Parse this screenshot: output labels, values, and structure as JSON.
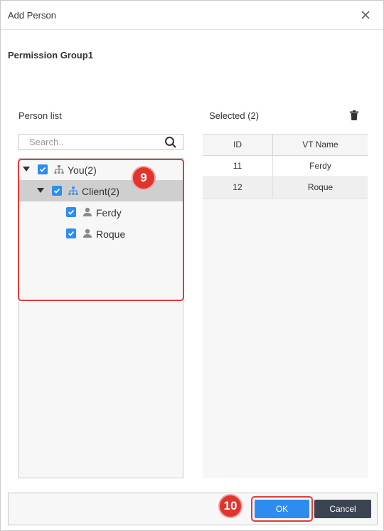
{
  "dialog": {
    "title": "Add Person"
  },
  "group": {
    "name": "Permission Group1"
  },
  "person_list": {
    "label": "Person list",
    "search_placeholder": "Search..",
    "tree": [
      {
        "label": "You(2)",
        "checked": true,
        "expanded": true,
        "icon": "org-icon",
        "level": 0
      },
      {
        "label": "Client(2)",
        "checked": true,
        "expanded": true,
        "icon": "org-icon",
        "level": 1,
        "selected": true
      },
      {
        "label": "Ferdy",
        "checked": true,
        "icon": "person-icon",
        "level": 2
      },
      {
        "label": "Roque",
        "checked": true,
        "icon": "person-icon",
        "level": 2
      }
    ]
  },
  "selected": {
    "label": "Selected (2)",
    "columns": {
      "id": "ID",
      "name": "VT Name"
    },
    "rows": [
      {
        "id": "11",
        "name": "Ferdy"
      },
      {
        "id": "12",
        "name": "Roque"
      }
    ]
  },
  "buttons": {
    "ok": "OK",
    "cancel": "Cancel"
  },
  "annotations": {
    "step_tree": "9",
    "step_ok": "10"
  },
  "colors": {
    "accent": "#2d8cf0",
    "annotation": "#e0352f",
    "cancel_bg": "#3b4450"
  }
}
